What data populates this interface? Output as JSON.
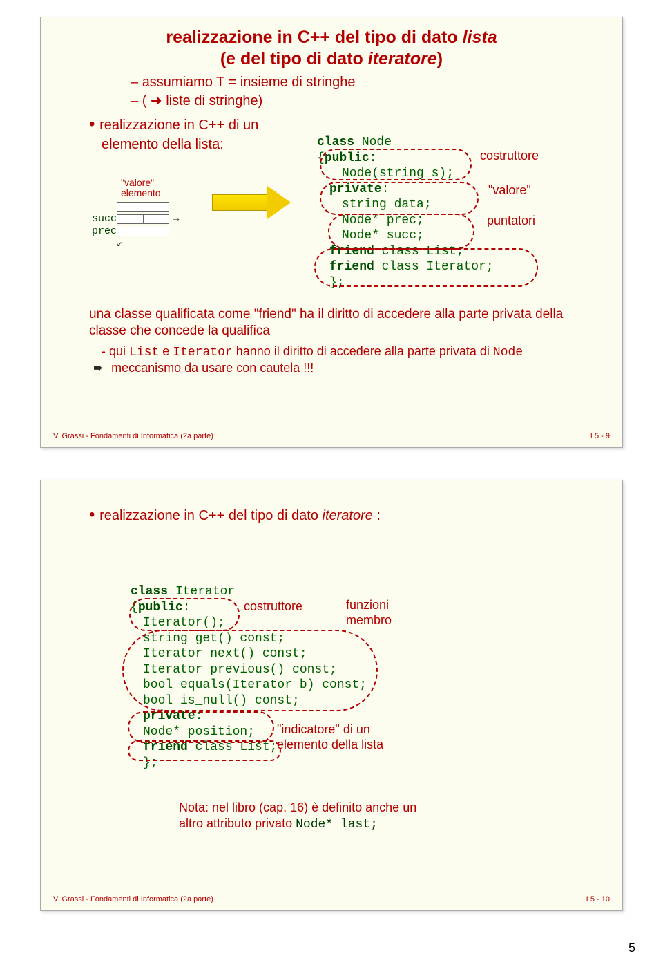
{
  "slide1": {
    "titleLine1": "realizzazione in C++ del tipo di dato ",
    "titleEm1": "lista",
    "titleLine2a": "(e del tipo di dato ",
    "titleEm2": "iteratore",
    "titleLine2b": ")",
    "dash1": "assumiamo T = insieme di stringhe",
    "dash2": "( ➜ liste di stringhe)",
    "bullet1a": "realizzazione in C++ di un",
    "bullet1b": "elemento della lista:",
    "diag": {
      "valore": "\"valore\"",
      "elemento": "elemento",
      "succ": "succ",
      "prec": "prec"
    },
    "code": {
      "l1a": "class",
      "l1b": " Node",
      "l2a": "{",
      "l2b": "public",
      "l2c": ":",
      "l3": "Node(string s);",
      "l4a": "private",
      "l4b": ":",
      "l5": "string data;",
      "l6": "Node* prec;",
      "l7": "Node* succ;",
      "l8a": "friend",
      "l8b": " class List;",
      "l9a": "friend",
      "l9b": " class Iterator;",
      "l10": "};"
    },
    "annot": {
      "costruttore": "costruttore",
      "valore": "\"valore\"",
      "puntatori": "puntatori"
    },
    "para1": "una classe qualificata come \"friend\" ha il diritto di accedere alla parte privata della classe che concede la qualifica",
    "para2a": "- qui ",
    "para2b": "List",
    "para2c": " e ",
    "para2d": "Iterator",
    "para2e": " hanno il diritto di accedere alla parte privata di ",
    "para2f": "Node",
    "para3": "meccanismo da usare con cautela !!!",
    "footerLeft": "V. Grassi - Fondamenti di Informatica (2a parte)",
    "footerRight": "L5 - 9"
  },
  "slide2": {
    "bullet": "realizzazione in C++ del tipo di dato ",
    "bulletEm": "iteratore",
    "bulletTail": " :",
    "code": {
      "l1a": "class",
      "l1b": " Iterator",
      "l2a": "{",
      "l2b": "public",
      "l2c": ":",
      "l3": "Iterator();",
      "l4": "string get() const;",
      "l5": "Iterator next() const;",
      "l6": "Iterator previous() const;",
      "l7": "bool equals(Iterator b) const;",
      "l8": "bool is_null() const;",
      "l9a": "private",
      "l9b": ":",
      "l10": "Node* position;",
      "l11a": "friend",
      "l11b": " class List;",
      "l12": "};"
    },
    "annot": {
      "costruttore": "costruttore",
      "funzioni": "funzioni",
      "membro": "membro",
      "indic1": "\"indicatore\" di un",
      "indic2": "elemento della lista"
    },
    "note1": "Nota: nel libro (cap. 16) è definito anche un",
    "note2a": "altro attributo privato ",
    "note2b": "Node* last;",
    "footerLeft": "V. Grassi - Fondamenti di Informatica (2a parte)",
    "footerRight": "L5 - 10"
  },
  "pageNumber": "5"
}
